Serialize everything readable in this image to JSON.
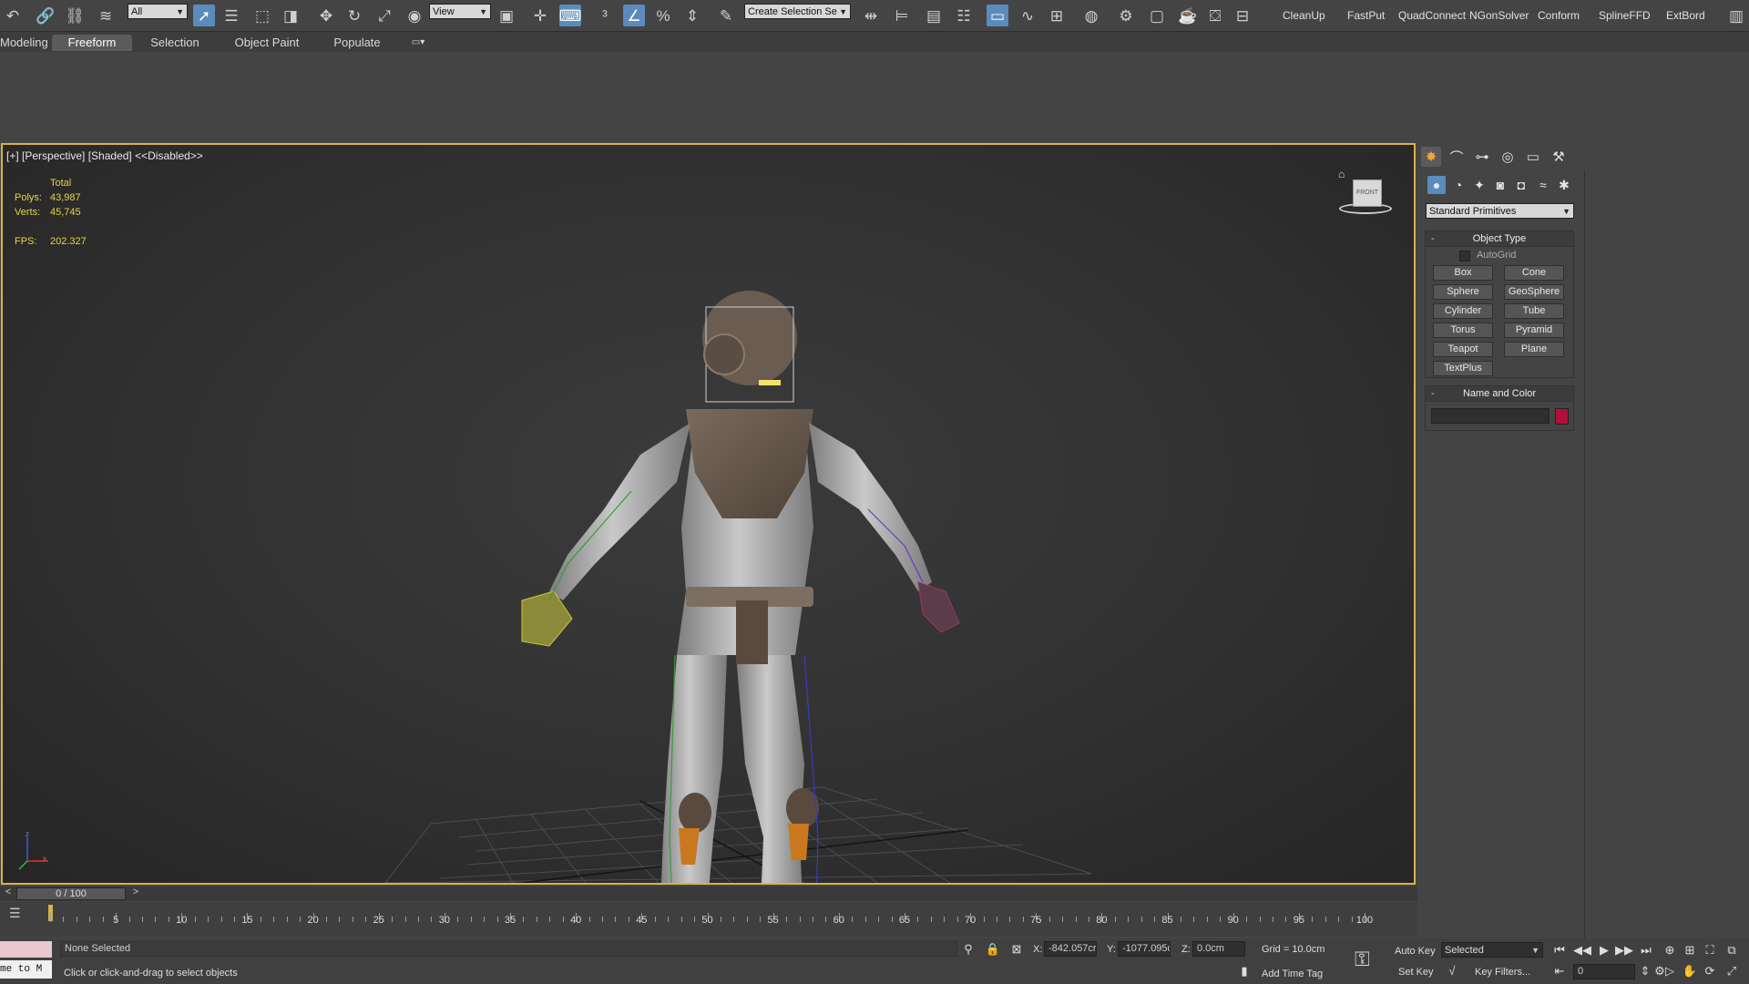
{
  "toolbar": {
    "selection_filter": "All",
    "ref_coord": "View",
    "named_selection": "Create Selection Se",
    "icons": [
      "undo-icon",
      "link-icon",
      "unlink-icon",
      "bind-spacewarp-icon",
      "select-object-icon",
      "select-by-name-icon",
      "rect-region-icon",
      "window-crossing-icon",
      "move-icon",
      "rotate-icon",
      "scale-icon",
      "placement-icon",
      "pivot-icon",
      "select-manipulate-icon",
      "keyboard-shortcut-icon",
      "snap-3d-icon",
      "angle-snap-icon",
      "percent-snap-icon",
      "spinner-snap-icon",
      "edit-named-sel-icon",
      "mirror-icon",
      "align-icon",
      "layers-icon",
      "scene-explorer-icon",
      "ribbon-icon",
      "curve-editor-icon",
      "schematic-icon",
      "material-editor-icon",
      "render-setup-icon",
      "rendered-frame-icon",
      "render-icon"
    ],
    "plugins": [
      "CleanUp",
      "FastPut",
      "QuadConnect",
      "NGonSolver",
      "Conform",
      "SplineFFD",
      "ExtBord"
    ]
  },
  "ribbon": {
    "tabs": [
      "Modeling",
      "Freeform",
      "Selection",
      "Object Paint",
      "Populate"
    ],
    "active_tab": "Freeform"
  },
  "viewport": {
    "label": "[+] [Perspective] [Shaded]",
    "label_extra": "<<Disabled>>",
    "stats": {
      "total_label": "Total",
      "polys_label": "Polys:",
      "polys": "43,987",
      "verts_label": "Verts:",
      "verts": "45,745",
      "fps_label": "FPS:",
      "fps": "202.327"
    },
    "viewcube_label": "FRONT",
    "axis_labels": {
      "z": "z",
      "x": "x"
    }
  },
  "command_panel": {
    "tabs": [
      "create-icon",
      "modify-icon",
      "hierarchy-icon",
      "motion-icon",
      "display-icon",
      "utilities-icon"
    ],
    "subtabs": [
      "geometry-icon",
      "shapes-icon",
      "lights-icon",
      "cameras-icon",
      "helpers-icon",
      "spacewarps-icon",
      "systems-icon"
    ],
    "category": "Standard Primitives",
    "object_type": {
      "title": "Object Type",
      "autogrid": "AutoGrid",
      "buttons": [
        "Box",
        "Cone",
        "Sphere",
        "GeoSphere",
        "Cylinder",
        "Tube",
        "Torus",
        "Pyramid",
        "Teapot",
        "Plane",
        "TextPlus"
      ]
    },
    "name_color": {
      "title": "Name and Color",
      "name_value": "",
      "swatch_color": "#b0103a"
    }
  },
  "timeline": {
    "frame_display": "0 / 100",
    "prev": "<",
    "next": ">",
    "tick_labels": [
      "0",
      "5",
      "10",
      "15",
      "20",
      "25",
      "30",
      "35",
      "40",
      "45",
      "50",
      "55",
      "60",
      "65",
      "70",
      "75",
      "80",
      "85",
      "90",
      "95",
      "100"
    ]
  },
  "status": {
    "maxscript_label": "me to M",
    "selection_status": "None Selected",
    "prompt": "Click or click-and-drag to select objects",
    "x_label": "X:",
    "x_value": "-842.057cr",
    "y_label": "Y:",
    "y_value": "-1077.095c",
    "z_label": "Z:",
    "z_value": "0.0cm",
    "grid": "Grid = 10.0cm",
    "add_time_tag": "Add Time Tag",
    "auto_key": "Auto Key",
    "set_key": "Set Key",
    "key_mode": "Selected",
    "key_filters": "Key Filters...",
    "current_frame": "0"
  },
  "colors": {
    "accent": "#5a8bbd",
    "viewport_border": "#d7b34a",
    "stats_text": "#e5d44a"
  }
}
